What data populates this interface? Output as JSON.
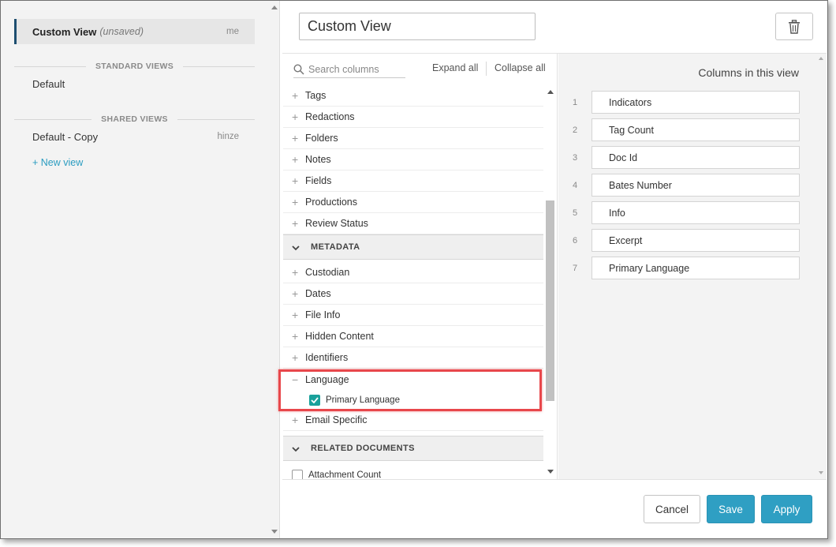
{
  "sidebar": {
    "active_view": {
      "name": "Custom View",
      "flag": "(unsaved)",
      "owner": "me"
    },
    "standard_header": "STANDARD VIEWS",
    "standard_views": [
      {
        "name": "Default"
      }
    ],
    "shared_header": "SHARED VIEWS",
    "shared_views": [
      {
        "name": "Default - Copy",
        "owner": "hinze"
      }
    ],
    "new_view_label": "+ New view"
  },
  "editor": {
    "view_name_value": "Custom View",
    "delete_icon": "trash-icon"
  },
  "chooser": {
    "search_placeholder": "Search columns",
    "expand_all": "Expand all",
    "collapse_all": "Collapse all",
    "top_groups": [
      "Tags",
      "Redactions",
      "Folders",
      "Notes",
      "Fields",
      "Productions",
      "Review Status"
    ],
    "metadata_header": "METADATA",
    "metadata_groups": [
      "Custodian",
      "Dates",
      "File Info",
      "Hidden Content",
      "Identifiers"
    ],
    "language_group": "Language",
    "language_children": [
      {
        "label": "Primary Language",
        "checked": true
      }
    ],
    "email_group": "Email Specific",
    "related_header": "RELATED DOCUMENTS",
    "related_items": [
      {
        "label": "Attachment Count",
        "checked": false
      }
    ]
  },
  "columns_panel": {
    "title": "Columns in this view",
    "columns": [
      {
        "num": "1",
        "label": "Indicators"
      },
      {
        "num": "2",
        "label": "Tag Count"
      },
      {
        "num": "3",
        "label": "Doc Id"
      },
      {
        "num": "4",
        "label": "Bates Number"
      },
      {
        "num": "5",
        "label": "Info"
      },
      {
        "num": "6",
        "label": "Excerpt"
      },
      {
        "num": "7",
        "label": "Primary Language"
      }
    ]
  },
  "footer": {
    "cancel": "Cancel",
    "save": "Save",
    "apply": "Apply"
  },
  "colors": {
    "accent": "#2f9fc3",
    "checkbox": "#1aa19b",
    "highlight": "#e8474b",
    "active_marker": "#1d4e70"
  }
}
